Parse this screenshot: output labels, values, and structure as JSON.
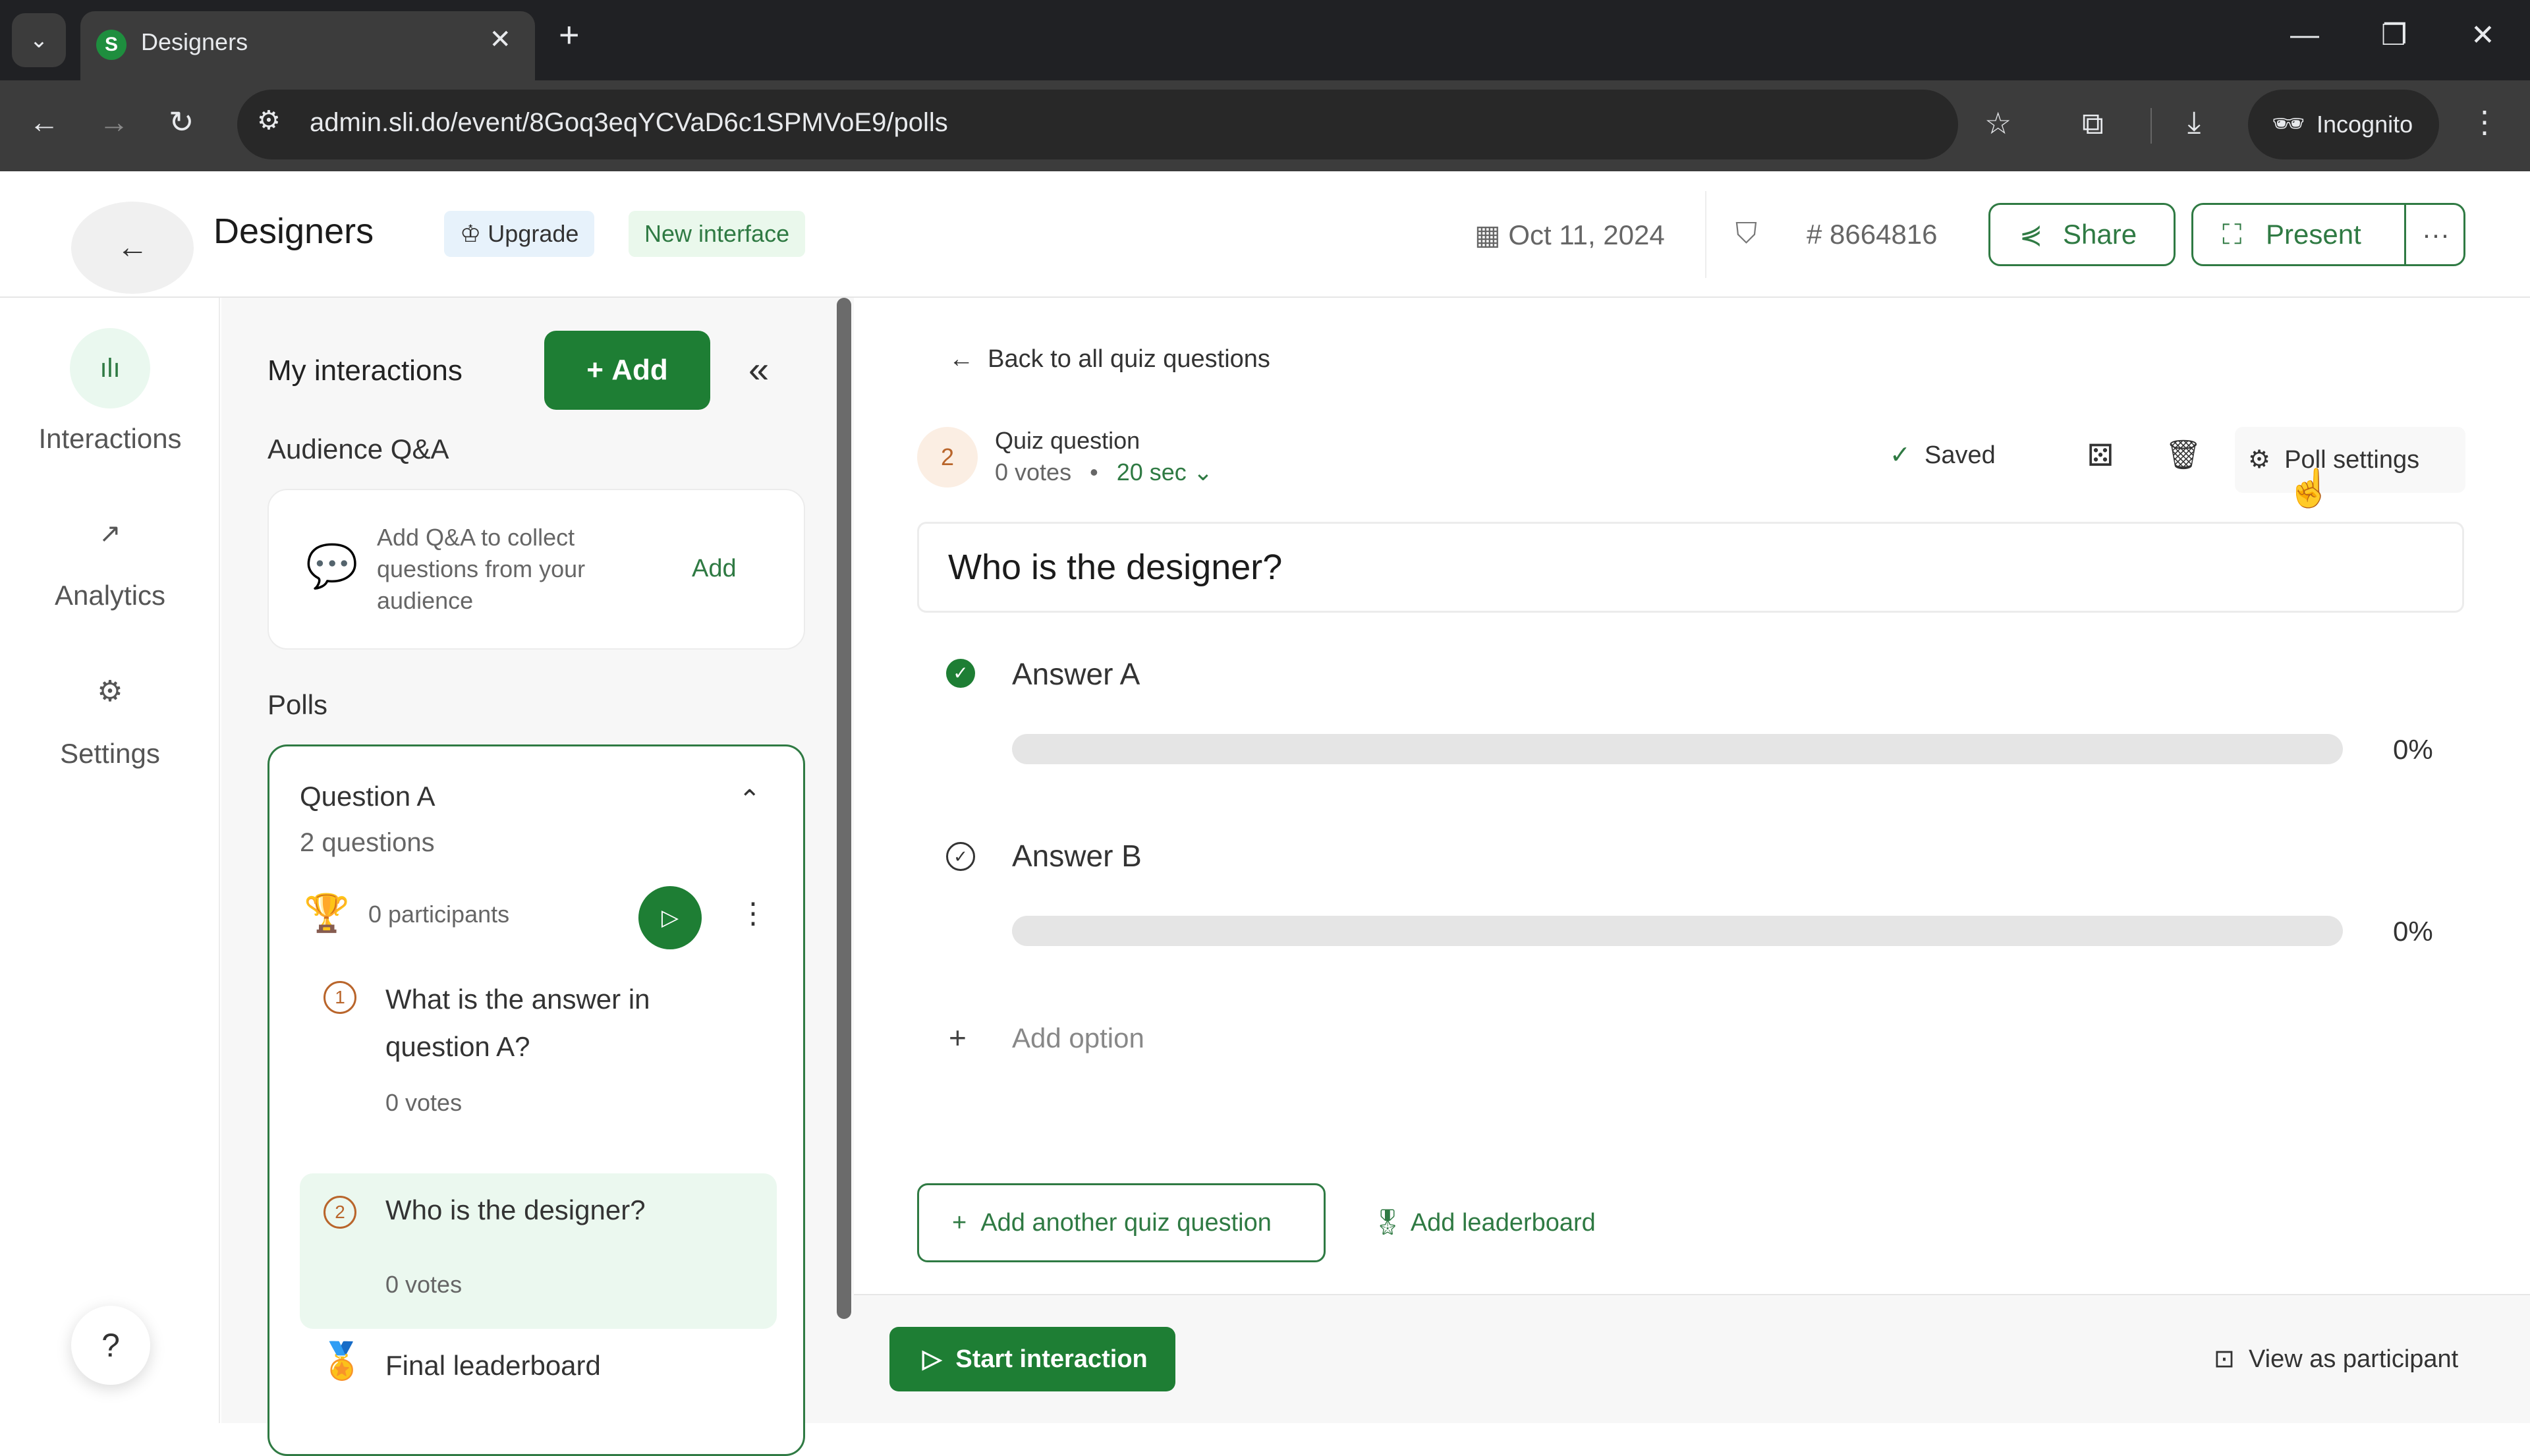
{
  "browser": {
    "tab_title": "Designers",
    "tab_favicon": "S",
    "url": "admin.sli.do/event/8Goq3eqYCVaD6c1SPMVoE9/polls",
    "profile_label": "Incognito"
  },
  "header": {
    "title": "Designers",
    "upgrade_label": "Upgrade",
    "new_interface_label": "New interface",
    "date": "Oct 11, 2024",
    "event_code": "# 8664816",
    "share_label": "Share",
    "present_label": "Present",
    "more_label": "···"
  },
  "rail": {
    "items": [
      {
        "label": "Interactions",
        "icon": "bar-chart-icon",
        "active": true
      },
      {
        "label": "Analytics",
        "icon": "trend-icon",
        "active": false
      },
      {
        "label": "Settings",
        "icon": "gear-icon",
        "active": false
      }
    ],
    "help_label": "?"
  },
  "sidebar": {
    "title": "My interactions",
    "add_label": "Add",
    "qa_section": "Audience Q&A",
    "qa_text": "Add Q&A to collect questions from your audience",
    "qa_add_label": "Add",
    "polls_section": "Polls",
    "poll": {
      "title": "Question A",
      "count": "2 questions",
      "participants": "0 participants",
      "questions": [
        {
          "num": "1",
          "text": "What is the answer in question A?",
          "votes": "0 votes",
          "selected": false
        },
        {
          "num": "2",
          "text": "Who is the designer?",
          "votes": "0 votes",
          "selected": true
        }
      ],
      "leaderboard": "Final leaderboard"
    }
  },
  "main": {
    "back_label": "Back to all quiz questions",
    "question_num": "2",
    "question_type": "Quiz question",
    "votes": "0 votes",
    "separator": "•",
    "timer": "20 sec",
    "saved_label": "Saved",
    "poll_settings_label": "Poll settings",
    "question_text": "Who is the designer?",
    "answers": [
      {
        "label": "Answer A",
        "correct": true,
        "percent_label": "0%",
        "percent": 0
      },
      {
        "label": "Answer B",
        "correct": false,
        "percent_label": "0%",
        "percent": 0
      }
    ],
    "add_option_label": "Add option",
    "add_question_label": "Add another quiz question",
    "add_leaderboard_label": "Add leaderboard"
  },
  "footer": {
    "start_label": "Start interaction",
    "view_participant_label": "View as participant"
  },
  "colors": {
    "brand_green": "#1e7e34",
    "accent_orange": "#b9652b"
  }
}
